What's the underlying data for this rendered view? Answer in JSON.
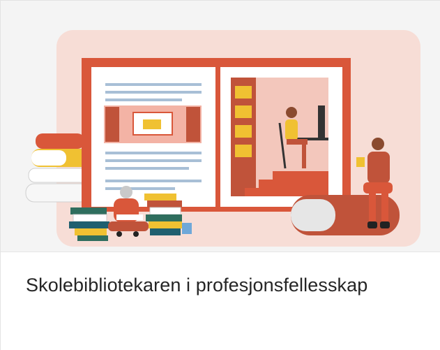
{
  "card": {
    "title": "Skolebibliotekaren i profesjonsfellesskap",
    "image_subject": "library illustration",
    "colors": {
      "background_panel": "#f7ddd6",
      "frame": "#d9573a",
      "shelf": "#c0533a",
      "title_text": "#252525"
    }
  }
}
